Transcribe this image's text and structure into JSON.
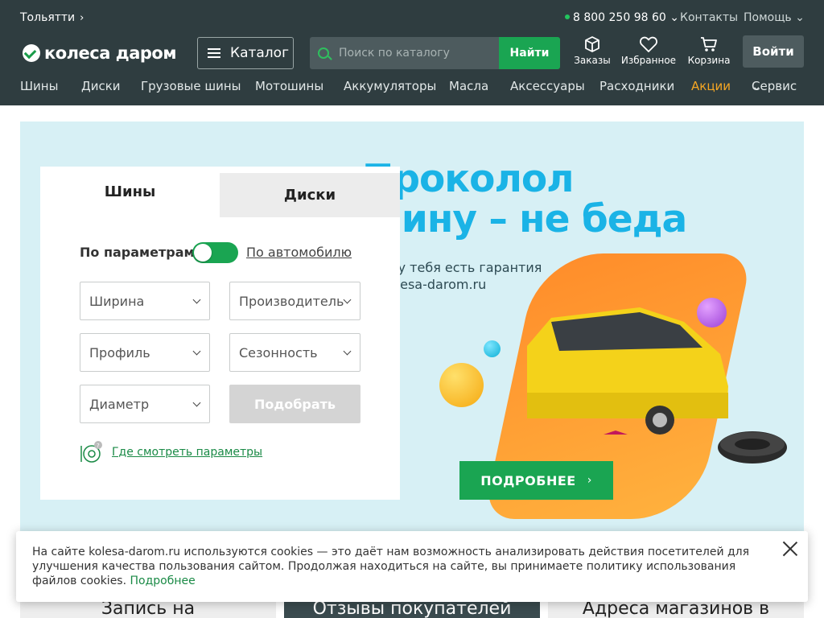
{
  "topbar": {
    "city": "Тольятти",
    "phone": "8 800 250 98 60",
    "contacts": "Контакты",
    "help": "Помощь"
  },
  "header": {
    "logo_text": "колеса даром",
    "catalog_label": "Каталог",
    "search_placeholder": "Поиск по каталогу",
    "search_button": "Найти",
    "orders_label": "Заказы",
    "favorites_label": "Избранное",
    "cart_label": "Корзина",
    "login_label": "Войти"
  },
  "nav": {
    "items": [
      "Шины",
      "Диски",
      "Грузовые шины",
      "Мотошины",
      "Аккумуляторы",
      "Масла",
      "Аксессуары",
      "Расходники",
      "Акции",
      "Сервис"
    ]
  },
  "banner": {
    "headline_line1": "Проколол",
    "headline_line2": "шину – не беда",
    "sub_line1": "Если у тебя есть гарантия",
    "sub_line2": "от kolesa-darom.ru",
    "more_button": "ПОДРОБНЕЕ"
  },
  "selector": {
    "tab_tires": "Шины",
    "tab_disks": "Диски",
    "mode_label": "По параметрам",
    "auto_link": "По автомобилю",
    "width": "Ширина",
    "manufacturer": "Производитель",
    "profile": "Профиль",
    "season": "Сезонность",
    "diameter": "Диаметр",
    "pick_button": "Подобрать",
    "params_link": "Где смотреть параметры"
  },
  "cards": [
    "Запись на",
    "Отзывы покупателей",
    "Адреса магазинов в"
  ],
  "cookie": {
    "text": "На сайте kolesa-darom.ru используются cookies — это даёт нам возможность анализировать действия посетителей для улучшения качества пользования сайтом. Продолжая находиться на сайте, вы принимаете политику использования файлов cookies.",
    "more_link": "Подробнее"
  },
  "colors": {
    "header_bg": "#2f3d40",
    "accent_green": "#1aa552",
    "promo_orange": "#f5a623",
    "headline_blue": "#1ab3e6"
  }
}
